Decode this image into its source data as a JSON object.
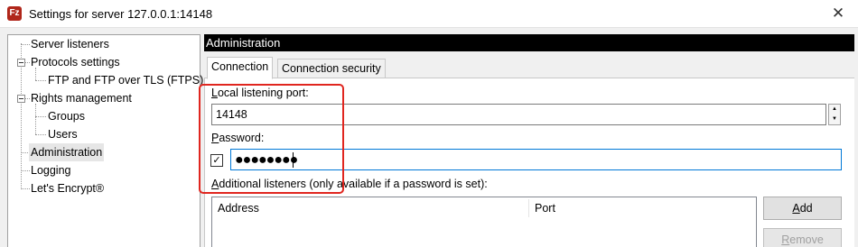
{
  "window": {
    "title": "Settings for server 127.0.0.1:14148",
    "app_icon_text": "Fz",
    "close_glyph": "✕"
  },
  "sidebar": {
    "items": [
      {
        "label": "Server listeners"
      },
      {
        "label": "Protocols settings"
      },
      {
        "label": "FTP and FTP over TLS (FTPS)"
      },
      {
        "label": "Rights management"
      },
      {
        "label": "Groups"
      },
      {
        "label": "Users"
      },
      {
        "label": "Administration",
        "selected": true
      },
      {
        "label": "Logging"
      },
      {
        "label": "Let's Encrypt®"
      }
    ]
  },
  "panel": {
    "header": "Administration",
    "tabs": [
      {
        "label": "Connection",
        "active": true
      },
      {
        "label": "Connection security",
        "active": false
      }
    ]
  },
  "form": {
    "port_label_first": "L",
    "port_label_rest": "ocal listening port:",
    "port_value": "14148",
    "password_label_first": "P",
    "password_label_rest": "assword:",
    "password_checked": true,
    "password_masked": "●●●●●●●●",
    "listeners_label_first": "A",
    "listeners_label_rest": "dditional listeners (only available if a password is set):",
    "columns": [
      "Address",
      "Port"
    ]
  },
  "buttons": {
    "add_first": "A",
    "add_rest": "dd",
    "remove_first": "R",
    "remove_rest": "emove"
  },
  "colors": {
    "accent_focus": "#0078d7",
    "annotation_red": "#e0261f",
    "header_bg": "#000000"
  }
}
